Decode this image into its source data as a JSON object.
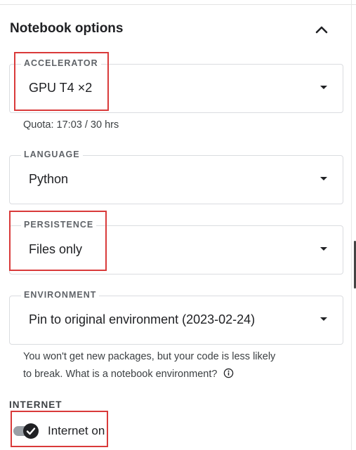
{
  "section": {
    "title": "Notebook options",
    "collapse_icon": "chevron-up-icon"
  },
  "accelerator": {
    "label": "ACCELERATOR",
    "value": "GPU T4 ×2",
    "quota": "Quota: 17:03 / 30 hrs"
  },
  "language": {
    "label": "LANGUAGE",
    "value": "Python"
  },
  "persistence": {
    "label": "PERSISTENCE",
    "value": "Files only"
  },
  "environment": {
    "label": "ENVIRONMENT",
    "value": "Pin to original environment (2023-02-24)",
    "help_line1": "You won't get new packages, but your code is less likely",
    "help_line2": "to break. What is a notebook environment?",
    "help_icon": "info-icon"
  },
  "internet": {
    "heading": "INTERNET",
    "toggle_label": "Internet on",
    "toggle_on": true
  },
  "colors": {
    "highlight": "#d93a3a",
    "border": "#dadce0",
    "text": "#202124"
  }
}
